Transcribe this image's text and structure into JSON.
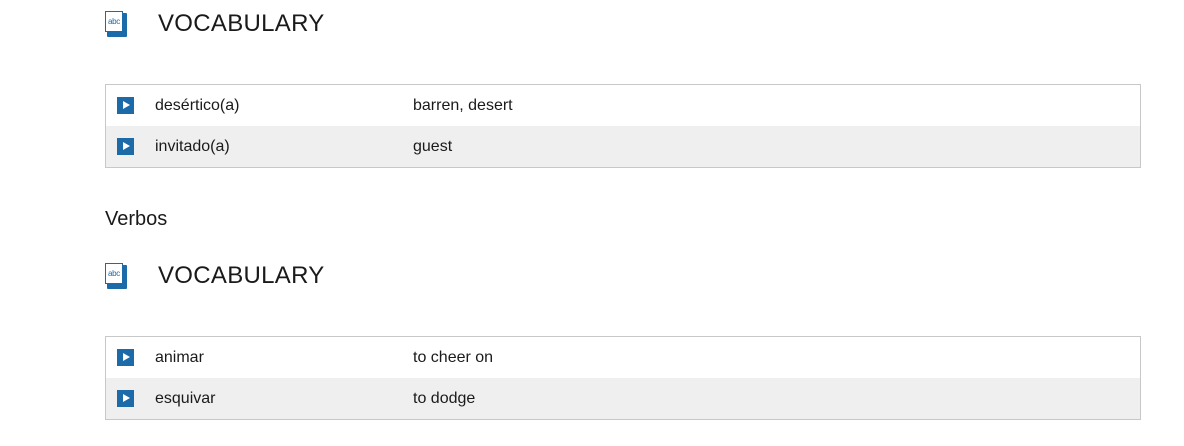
{
  "sections": [
    {
      "header": {
        "icon": "abc-book-icon",
        "icon_text": "abc",
        "title": "VOCABULARY"
      },
      "rows": [
        {
          "term": "desértico(a)",
          "translation": "barren, desert"
        },
        {
          "term": "invitado(a)",
          "translation": "guest"
        }
      ]
    },
    {
      "heading": "Verbos",
      "header": {
        "icon": "abc-book-icon",
        "icon_text": "abc",
        "title": "VOCABULARY"
      },
      "rows": [
        {
          "term": "animar",
          "translation": "to cheer on"
        },
        {
          "term": "esquivar",
          "translation": "to dodge"
        }
      ]
    }
  ],
  "colors": {
    "accent": "#1c6aa8",
    "row_alt": "#efefef",
    "border": "#c8c8c8"
  }
}
